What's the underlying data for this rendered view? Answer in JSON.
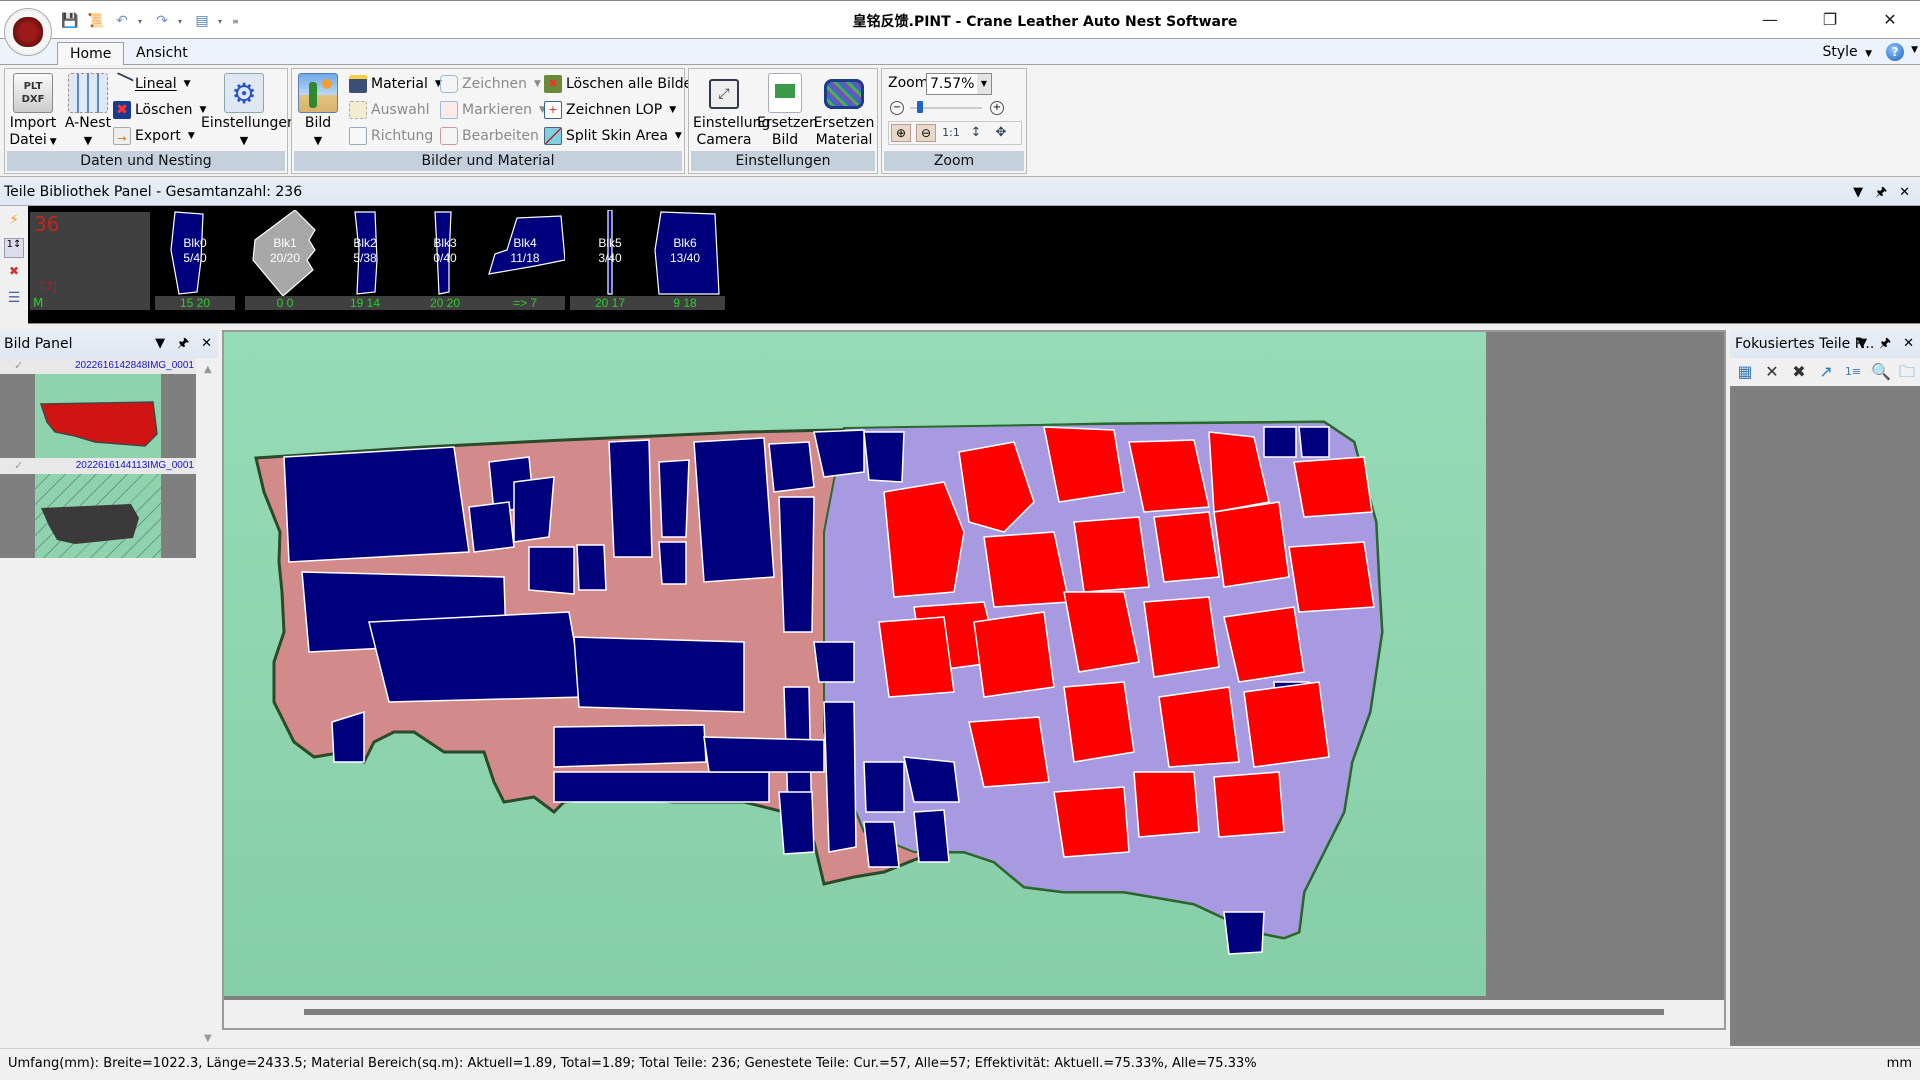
{
  "window": {
    "title": "皇铭反馈.PINT - Crane Leather Auto Nest Software",
    "minimize": "—",
    "restore": "❐",
    "close": "✕"
  },
  "quick_access": {
    "icons": [
      "save-icon",
      "script-icon",
      "undo-icon",
      "redo-icon",
      "layout-icon",
      "customize-icon"
    ]
  },
  "tabs": [
    {
      "label": "Home",
      "active": true
    },
    {
      "label": "Ansicht",
      "active": false
    }
  ],
  "style_menu": "Style",
  "ribbon": {
    "groups": [
      {
        "label": "Daten und Nesting",
        "big": [
          {
            "line1": "Import",
            "line2": "Datei",
            "icon": "plt-dxf-import-icon"
          },
          {
            "line1": "A-Nest",
            "line2": "",
            "icon": "auto-nest-icon"
          },
          {
            "line1": "Einstellungen",
            "line2": "",
            "icon": "settings-gear-icon"
          }
        ],
        "small": [
          {
            "label": "Lineal",
            "icon": "ruler-icon",
            "dropdown": true,
            "enabled": true
          },
          {
            "label": "Löschen",
            "icon": "delete-icon",
            "dropdown": true,
            "enabled": true
          },
          {
            "label": "Export",
            "icon": "export-dxf-icon",
            "dropdown": true,
            "enabled": true
          }
        ]
      },
      {
        "label": "Bilder und Material",
        "big": [
          {
            "line1": "Bild",
            "line2": "",
            "icon": "image-cactus-icon"
          }
        ],
        "small": [
          {
            "label": "Material",
            "icon": "material-icon",
            "dropdown": true,
            "enabled": true
          },
          {
            "label": "Auswahl",
            "icon": "selection-icon",
            "dropdown": false,
            "enabled": false
          },
          {
            "label": "Richtung",
            "icon": "direction-icon",
            "dropdown": false,
            "enabled": false
          },
          {
            "label": "Zeichnen",
            "icon": "draw-icon",
            "dropdown": true,
            "enabled": false
          },
          {
            "label": "Markieren",
            "icon": "mark-icon",
            "dropdown": true,
            "enabled": false
          },
          {
            "label": "Bearbeiten",
            "icon": "edit-icon",
            "dropdown": false,
            "enabled": false
          },
          {
            "label": "Löschen alle Bilder",
            "icon": "delete-all-images-icon",
            "dropdown": false,
            "enabled": true
          },
          {
            "label": "Zeichnen LOP",
            "icon": "draw-lop-icon",
            "dropdown": true,
            "enabled": true
          },
          {
            "label": "Split Skin Area",
            "icon": "split-skin-icon",
            "dropdown": true,
            "enabled": true
          }
        ]
      },
      {
        "label": "Einstellungen",
        "big": [
          {
            "line1": "Einstellung",
            "line2": "Camera",
            "icon": "camera-frame-icon"
          },
          {
            "line1": "Ersetzen",
            "line2": "Bild",
            "icon": "replace-image-icon"
          },
          {
            "line1": "Ersetzen",
            "line2": "Material",
            "icon": "replace-material-icon"
          }
        ]
      },
      {
        "label": "Zoom",
        "zoom_label": "Zoom",
        "zoom_value": "7.57%",
        "zoom_slider_fraction": 0.1,
        "buttons": [
          "zoom-in-icon",
          "zoom-out-icon",
          "zoom-1-1-icon",
          "zoom-fit-height-icon",
          "zoom-fit-all-icon"
        ]
      }
    ]
  },
  "library": {
    "header": "Teile Bibliothek Panel - Gesamtanzahl: 236",
    "summary_count": "36",
    "summary_sub": "[7]",
    "summary_m": "M",
    "blocks": [
      {
        "name": "Blk0",
        "ratio": "5/40",
        "counts": "15  20",
        "color": "#00007f"
      },
      {
        "name": "Blk1",
        "ratio": "20/20",
        "counts": "0    0",
        "color": "#a8a8a8"
      },
      {
        "name": "Blk2",
        "ratio": "5/38",
        "counts": "19  14",
        "color": "#00007f"
      },
      {
        "name": "Blk3",
        "ratio": "0/40",
        "counts": "20  20",
        "color": "#00007f"
      },
      {
        "name": "Blk4",
        "ratio": "11/18",
        "counts": "=>   7",
        "color": "#00007f"
      },
      {
        "name": "Blk5",
        "ratio": "3/40",
        "counts": "20  17",
        "color": "#00007f"
      },
      {
        "name": "Blk6",
        "ratio": "13/40",
        "counts": "9    18",
        "color": "#00007f"
      }
    ]
  },
  "bild_panel": {
    "title": "Bild Panel",
    "images": [
      {
        "name": "2022616142848IMG_0001",
        "checked": true
      },
      {
        "name": "2022616144113IMG_0001",
        "checked": true
      }
    ]
  },
  "focus_panel": {
    "title": "Fokusiertes Teile P...",
    "tools": [
      "add-part-icon",
      "delete-icon",
      "delete-zero-icon",
      "export-part-icon",
      "counter-icon",
      "zoom-part-icon",
      "folder-icon"
    ]
  },
  "status": {
    "text": "Umfang(mm): Breite=1022.3, Länge=2433.5; Material Bereich(sq.m): Aktuell=1.89, Total=1.89; Total Teile: 236; Genestete Teile: Cur.=57, Alle=57; Effektivität: Aktuell.=75.33%, Alle=75.33%",
    "unit": "mm"
  },
  "colors": {
    "nested_part": "#00007f",
    "highlight_part": "#ff0000",
    "leather": "#d28a8a",
    "leather_alt": "#a89ae0",
    "background_table": "#8fd5b0"
  }
}
